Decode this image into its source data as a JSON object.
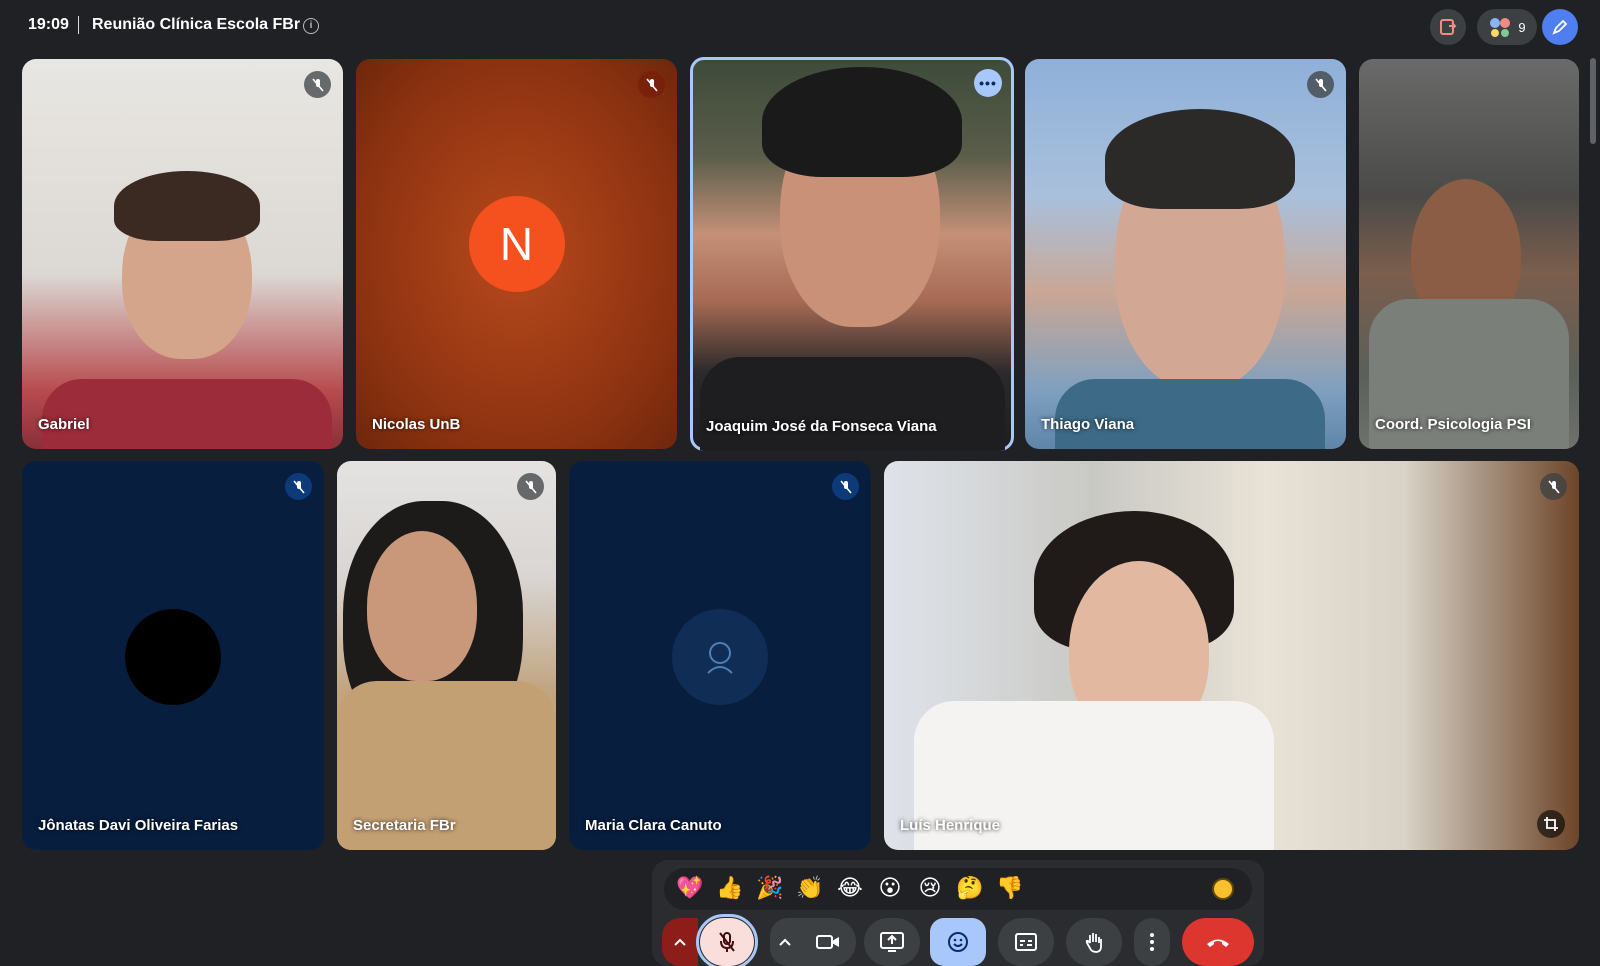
{
  "meeting": {
    "time": "19:09",
    "title": "Reunião Clínica Escola FBr",
    "participants_count": "9"
  },
  "tiles": [
    {
      "name": "Gabriel",
      "muted": true
    },
    {
      "name": "Nicolas UnB",
      "initial": "N",
      "muted": true
    },
    {
      "name": "Joaquim José da Fonseca Viana",
      "speaking": true
    },
    {
      "name": "Thiago Viana",
      "muted": true
    },
    {
      "name": "Coord. Psicologia PSI"
    },
    {
      "name": "Jônatas Davi Oliveira Farias",
      "muted": true
    },
    {
      "name": "Secretaria FBr",
      "muted": true
    },
    {
      "name": "Maria Clara Canuto",
      "muted": true
    },
    {
      "name": "Luís Henrique",
      "muted": true
    }
  ],
  "reactions": [
    "💖",
    "👍",
    "🎉",
    "👏",
    "😂",
    "😮",
    "😢",
    "🤔",
    "👎"
  ],
  "colors": {
    "background": "#202124",
    "accent_blue": "#a8c7fa",
    "leave_red": "#dc362e",
    "avatar_orange": "#f4511e",
    "tile_navy": "#071e3f"
  },
  "icons": {
    "info": "info-icon",
    "activities": "activities-icon",
    "people": "people-icon",
    "assistant": "pen-icon",
    "mic_off": "mic-off-icon",
    "more": "more-icon",
    "crop": "crop-icon",
    "camera": "camera-icon",
    "present": "present-icon",
    "emoji": "emoji-icon",
    "captions": "captions-icon",
    "hand": "hand-icon",
    "leave": "leave-call-icon"
  }
}
